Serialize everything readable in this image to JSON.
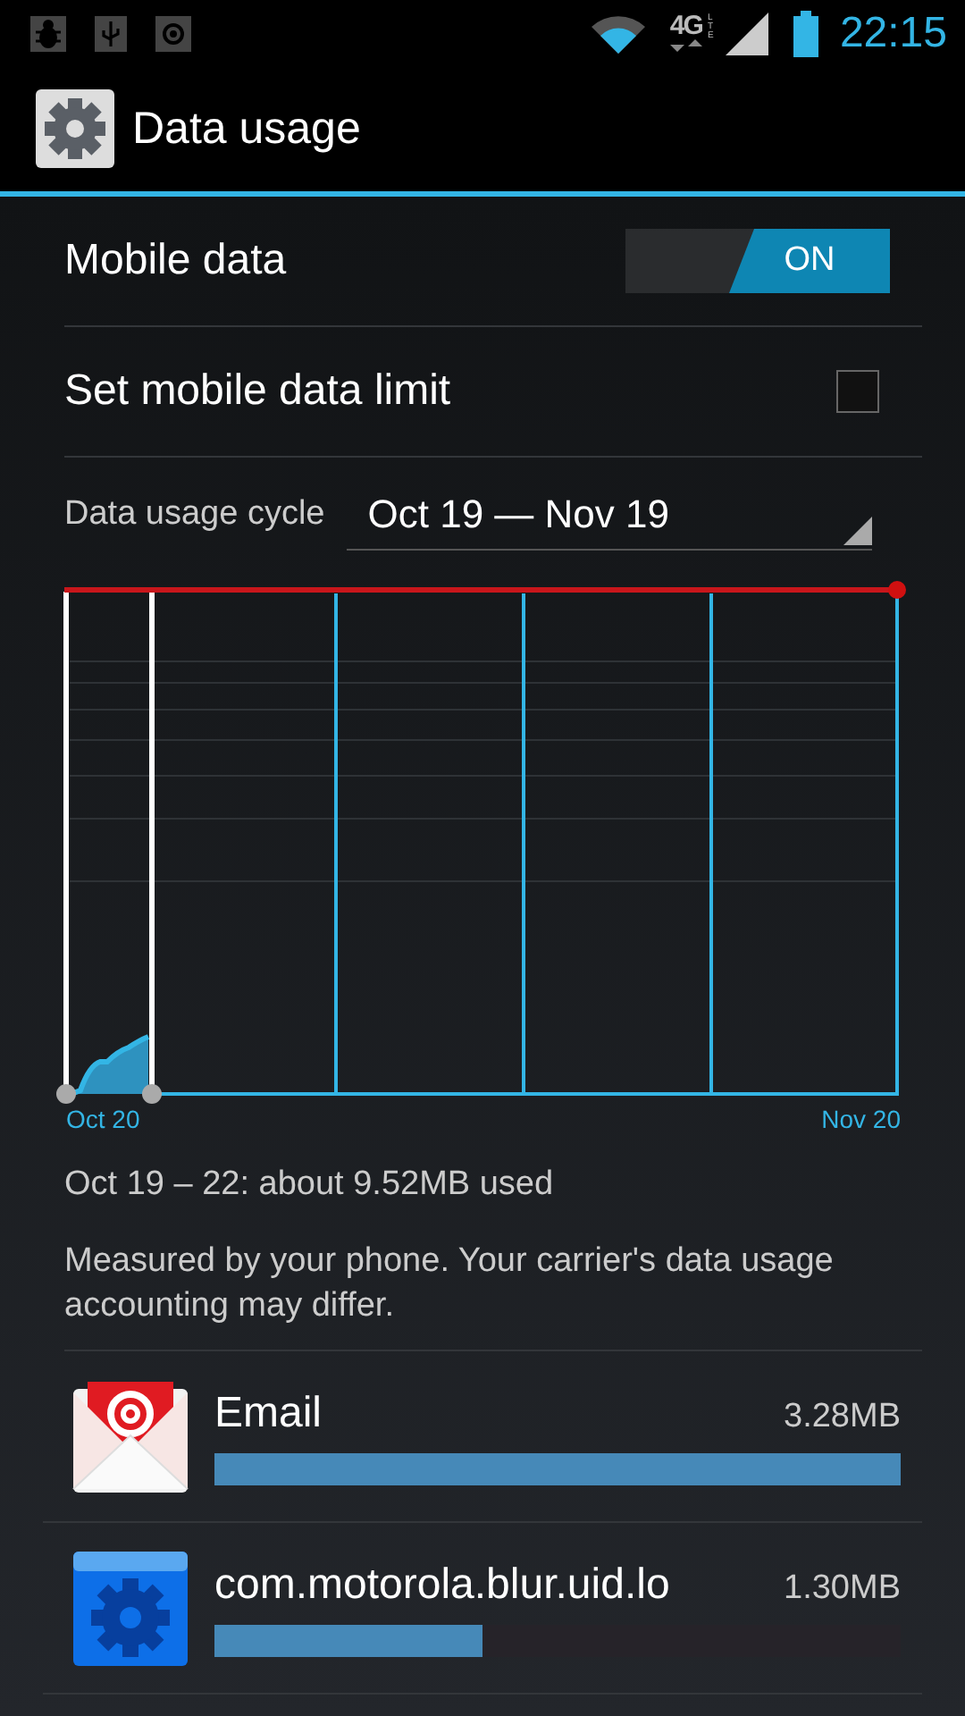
{
  "status_bar": {
    "network": "4G",
    "network_sub": "LTE",
    "time": "22:15"
  },
  "action_bar": {
    "title": "Data usage"
  },
  "settings": [
    {
      "kind": "switch",
      "label": "Mobile data",
      "on": true,
      "state_label": "ON"
    },
    {
      "kind": "checkbox",
      "label": "Set mobile data limit",
      "checked": false
    }
  ],
  "cycle": {
    "label": "Data usage cycle",
    "value": "Oct 19 — Nov 19"
  },
  "chart": {
    "start_label": "Oct 20",
    "end_label": "Nov 20"
  },
  "summary": "Oct 19 – 22: about 9.52MB used",
  "note": "Measured by your phone. Your carrier's data usage accounting may differ.",
  "apps": [
    {
      "kind": "email",
      "name": "Email",
      "amount": "3.28MB",
      "level": 1
    },
    {
      "kind": "system",
      "name": "com.motorola.blur.uid.lo",
      "amount": "1.30MB",
      "level": 0.39
    }
  ]
}
